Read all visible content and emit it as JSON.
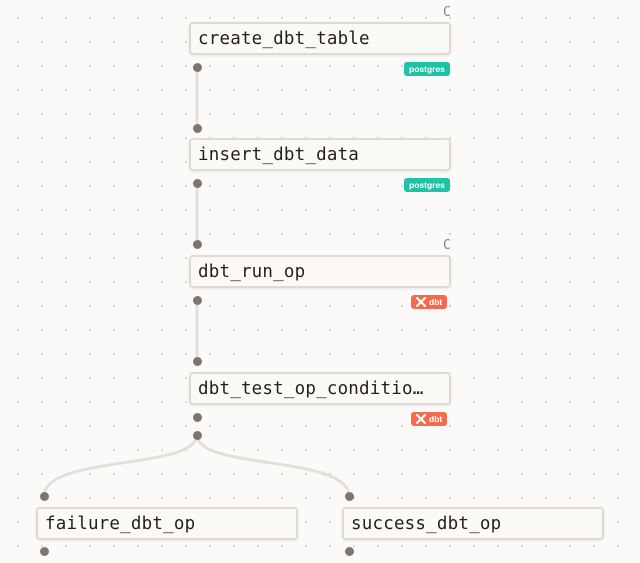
{
  "graph": {
    "nodes": [
      {
        "label": "create_dbt_table",
        "tag": "postgres",
        "corner": "C"
      },
      {
        "label": "insert_dbt_data",
        "tag": "postgres",
        "corner": ""
      },
      {
        "label": "dbt_run_op",
        "tag": "dbt",
        "corner": "C"
      },
      {
        "label": "dbt_test_op_conditio…",
        "tag": "dbt",
        "corner": ""
      },
      {
        "label": "failure_dbt_op",
        "tag": "",
        "corner": ""
      },
      {
        "label": "success_dbt_op",
        "tag": "",
        "corner": ""
      }
    ],
    "edges": [
      {
        "from": "create_dbt_table",
        "to": "insert_dbt_data"
      },
      {
        "from": "insert_dbt_data",
        "to": "dbt_run_op"
      },
      {
        "from": "dbt_run_op",
        "to": "dbt_test_op_conditio…"
      },
      {
        "from": "dbt_test_op_conditio…",
        "to": "failure_dbt_op"
      },
      {
        "from": "dbt_test_op_conditio…",
        "to": "success_dbt_op"
      }
    ]
  },
  "colors": {
    "postgres_tag": "#1ec2a5",
    "dbt_tag": "#f26b4f",
    "edge": "#e3e0db",
    "port": "#7b7670"
  }
}
